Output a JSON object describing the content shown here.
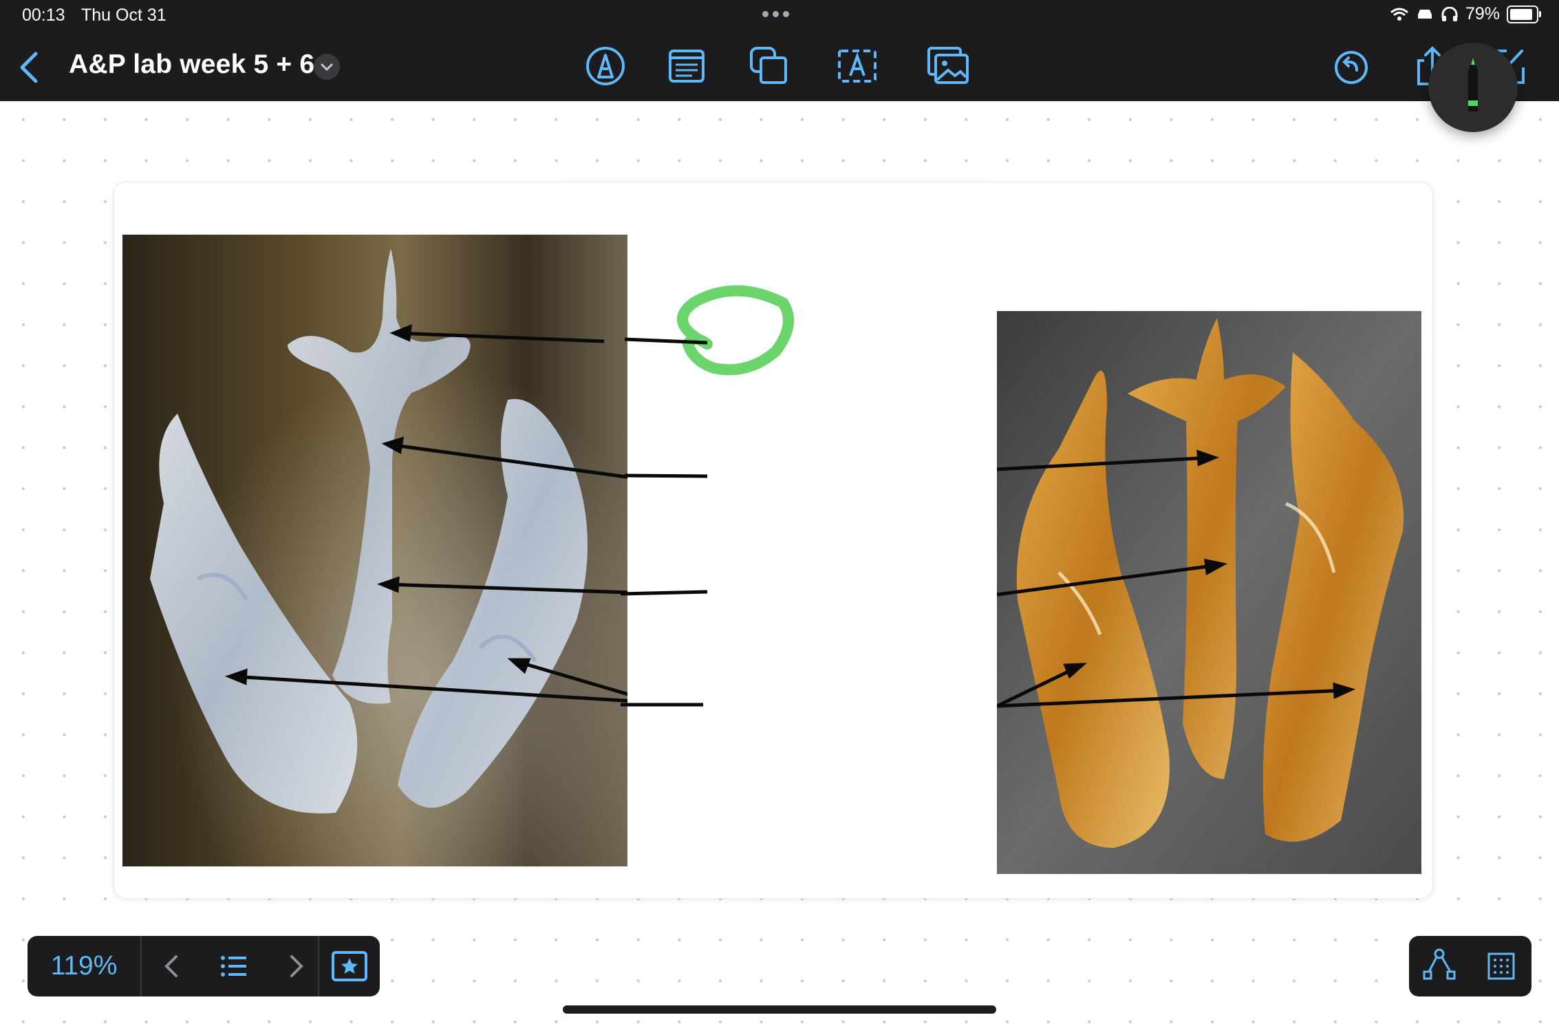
{
  "status_bar": {
    "time": "00:13",
    "date": "Thu Oct 31",
    "battery": "79%"
  },
  "toolbar": {
    "title": "A&P lab week 5 + 6",
    "icons": [
      "back-chevron-icon",
      "title-menu-chevron-icon",
      "pen-tool-icon",
      "note-icon",
      "shapes-icon",
      "text-box-icon",
      "image-icon",
      "undo-icon",
      "share-icon",
      "new-note-icon"
    ]
  },
  "canvas": {
    "left_image": "clear cartilage model of larynx and arytenoids",
    "right_image": "amber cartilage model of larynx and arytenoids",
    "annotation_color": "#6bd46b"
  },
  "bottom_bar": {
    "zoom": "119%"
  },
  "colors": {
    "toolbar_bg": "#1c1c1e",
    "accent_blue": "#5fb8f7",
    "pencil_green": "#4cd964"
  }
}
